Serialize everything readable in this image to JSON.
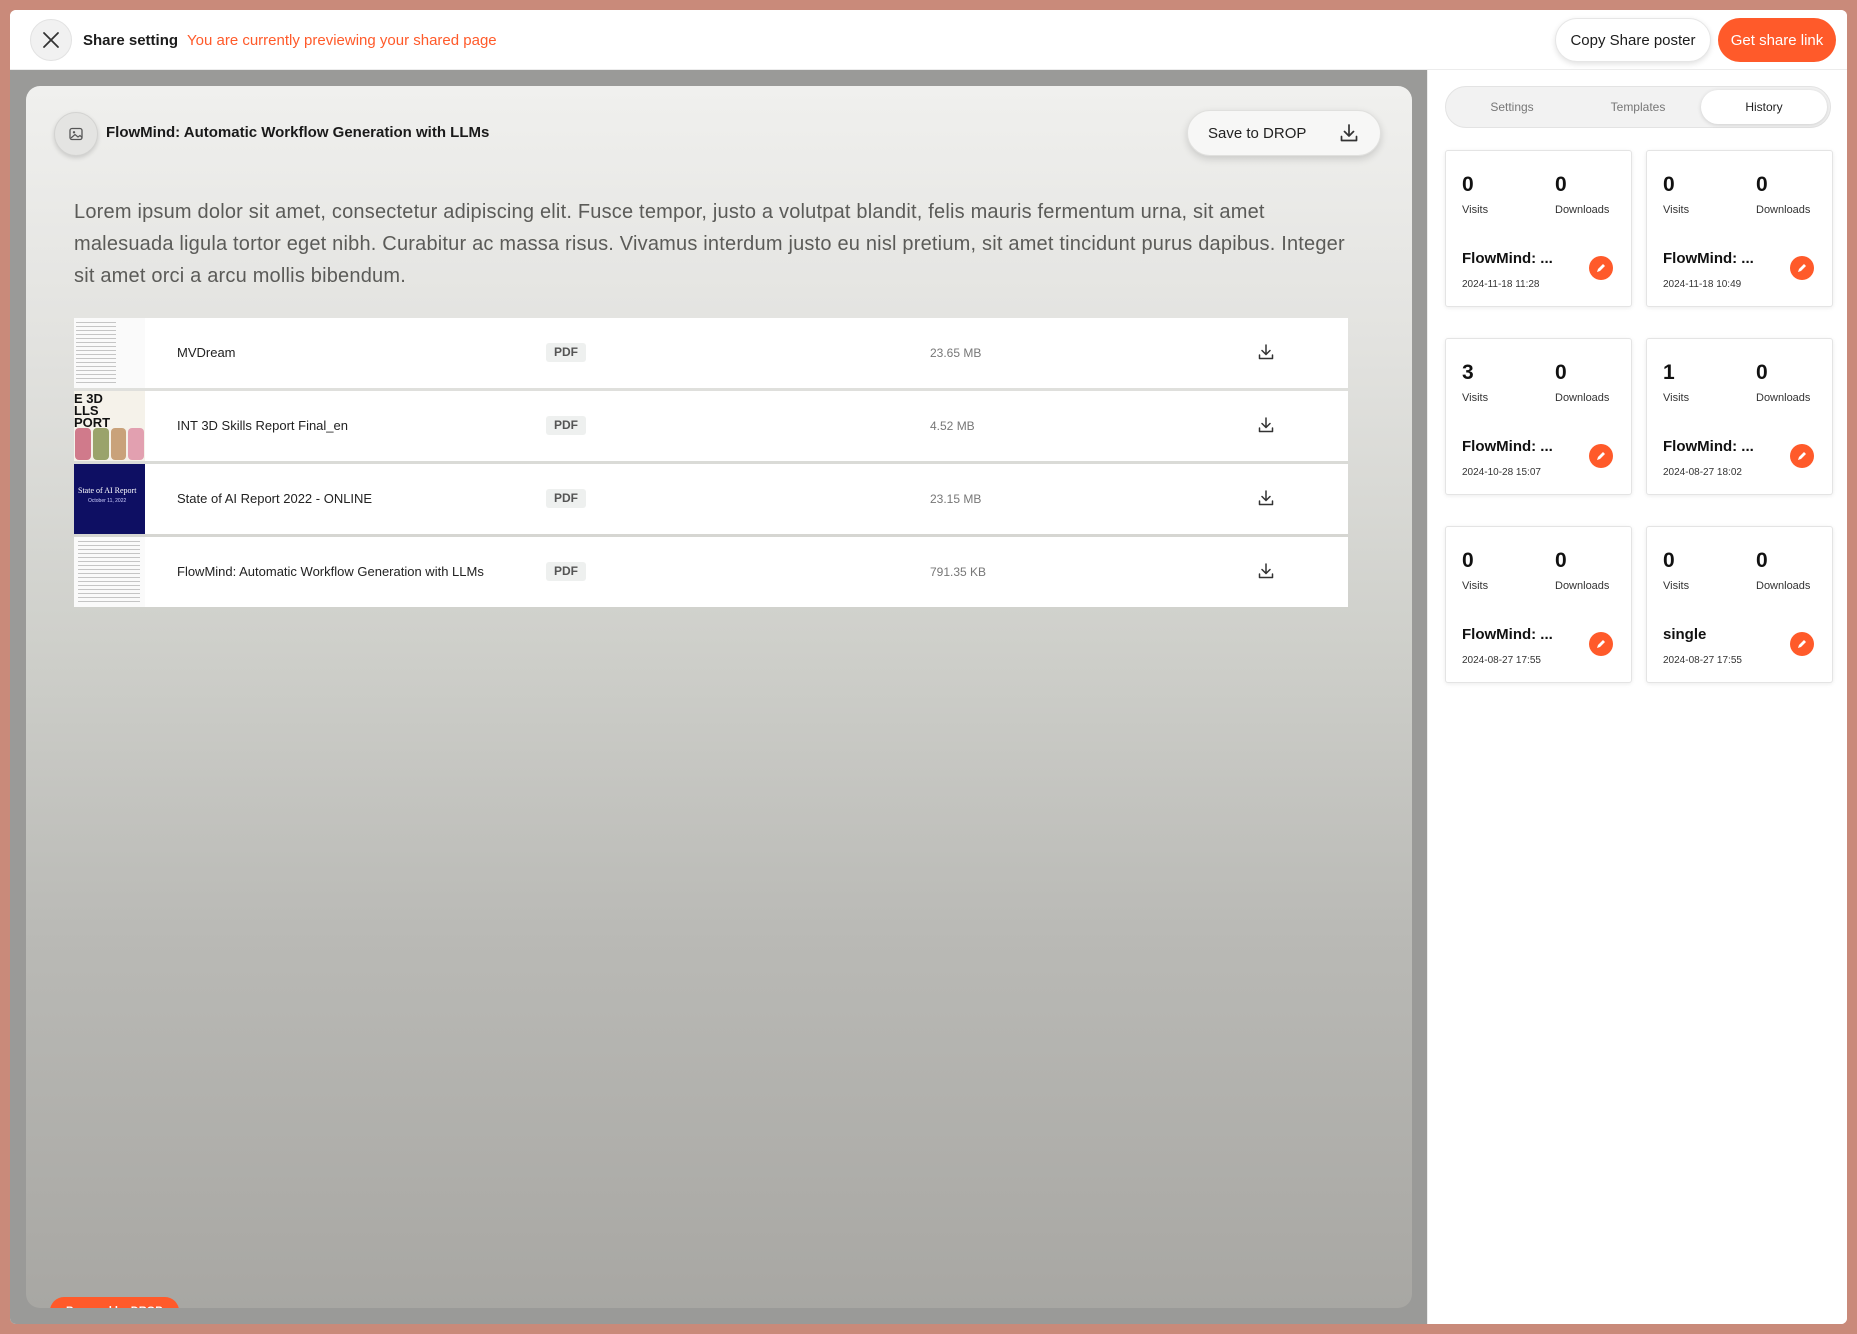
{
  "topbar": {
    "title": "Share setting",
    "preview_notice": "You are currently previewing your shared page",
    "copy_poster_label": "Copy Share poster",
    "get_link_label": "Get share link"
  },
  "preview": {
    "page_title": "FlowMind: Automatic Workflow Generation with LLMs",
    "save_label": "Save to DROP",
    "description": "Lorem ipsum dolor sit amet, consectetur adipiscing elit. Fusce tempor, justo a volutpat blandit, felis mauris fermentum urna, sit amet malesuada ligula tortor eget nibh. Curabitur ac massa risus. Vivamus interdum justo eu nisl pretium, sit amet tincidunt purus dapibus. Integer sit amet orci a arcu mollis bibendum.",
    "files": [
      {
        "name": "MVDream",
        "type": "PDF",
        "size": "23.65 MB"
      },
      {
        "name": "INT 3D Skills Report Final_en",
        "type": "PDF",
        "size": "4.52 MB",
        "thumb_text": "E 3D\nLLS\nPORT"
      },
      {
        "name": "State of AI Report 2022 - ONLINE",
        "type": "PDF",
        "size": "23.15 MB",
        "thumb_title": "State of AI Report",
        "thumb_sub": "October 11, 2022"
      },
      {
        "name": "FlowMind: Automatic Workflow Generation with LLMs",
        "type": "PDF",
        "size": "791.35 KB"
      }
    ],
    "powered_by": "Powered by DROP"
  },
  "panel": {
    "tabs": [
      {
        "label": "Settings",
        "active": false
      },
      {
        "label": "Templates",
        "active": false
      },
      {
        "label": "History",
        "active": true
      }
    ],
    "history": [
      {
        "visits": "0",
        "downloads": "0",
        "visits_label": "Visits",
        "downloads_label": "Downloads",
        "title": "FlowMind: ...",
        "date": "2024-11-18 11:28"
      },
      {
        "visits": "0",
        "downloads": "0",
        "visits_label": "Visits",
        "downloads_label": "Downloads",
        "title": "FlowMind: ...",
        "date": "2024-11-18 10:49"
      },
      {
        "visits": "3",
        "downloads": "0",
        "visits_label": "Visits",
        "downloads_label": "Downloads",
        "title": "FlowMind: ...",
        "date": "2024-10-28 15:07"
      },
      {
        "visits": "1",
        "downloads": "0",
        "visits_label": "Visits",
        "downloads_label": "Downloads",
        "title": "FlowMind: ...",
        "date": "2024-08-27 18:02"
      },
      {
        "visits": "0",
        "downloads": "0",
        "visits_label": "Visits",
        "downloads_label": "Downloads",
        "title": "FlowMind: ...",
        "date": "2024-08-27 17:55"
      },
      {
        "visits": "0",
        "downloads": "0",
        "visits_label": "Visits",
        "downloads_label": "Downloads",
        "title": "single",
        "date": "2024-08-27 17:55"
      }
    ]
  },
  "colors": {
    "accent": "#ff5a2a",
    "frame": "#c98a7a",
    "ai_report_blue": "#0e0f63"
  },
  "icons": {
    "close": "close-icon",
    "image": "image-icon",
    "download": "download-icon",
    "edit": "pencil-icon"
  }
}
